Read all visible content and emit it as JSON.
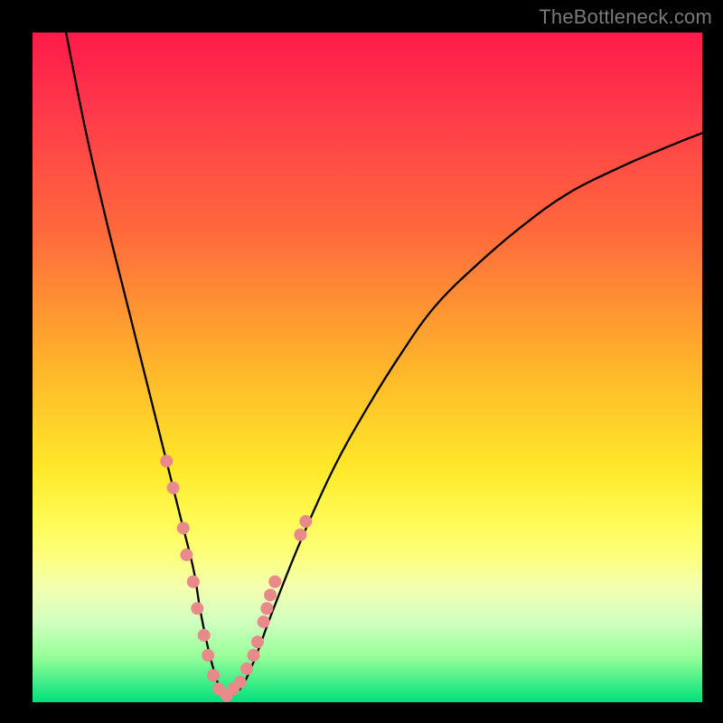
{
  "watermark": "TheBottleneck.com",
  "chart_data": {
    "type": "line",
    "title": "",
    "xlabel": "",
    "ylabel": "",
    "xlim": [
      0,
      100
    ],
    "ylim": [
      0,
      100
    ],
    "grid": false,
    "legend": false,
    "series": [
      {
        "name": "bottleneck-curve",
        "stroke": "#000000",
        "smooth": true,
        "x": [
          5,
          8,
          11,
          14,
          17,
          20,
          22,
          24,
          25,
          26,
          27,
          28,
          29,
          31,
          33,
          36,
          40,
          45,
          50,
          55,
          60,
          66,
          73,
          80,
          88,
          95,
          100
        ],
        "values": [
          100,
          85,
          72,
          60,
          48,
          36,
          28,
          20,
          14,
          9,
          5,
          2,
          1,
          2,
          6,
          14,
          24,
          35,
          44,
          52,
          59,
          65,
          71,
          76,
          80,
          83,
          85
        ]
      }
    ],
    "markers": {
      "name": "highlight-dots",
      "color": "#e98a8a",
      "radius": 7,
      "points": [
        {
          "x": 20.0,
          "y": 36
        },
        {
          "x": 21.0,
          "y": 32
        },
        {
          "x": 22.5,
          "y": 26
        },
        {
          "x": 23.0,
          "y": 22
        },
        {
          "x": 24.0,
          "y": 18
        },
        {
          "x": 24.6,
          "y": 14
        },
        {
          "x": 25.6,
          "y": 10
        },
        {
          "x": 26.2,
          "y": 7
        },
        {
          "x": 27.0,
          "y": 4
        },
        {
          "x": 27.8,
          "y": 2
        },
        {
          "x": 29.0,
          "y": 1
        },
        {
          "x": 30.0,
          "y": 2
        },
        {
          "x": 31.0,
          "y": 3
        },
        {
          "x": 32.0,
          "y": 5
        },
        {
          "x": 33.0,
          "y": 7
        },
        {
          "x": 33.6,
          "y": 9
        },
        {
          "x": 34.5,
          "y": 12
        },
        {
          "x": 35.0,
          "y": 14
        },
        {
          "x": 35.5,
          "y": 16
        },
        {
          "x": 36.2,
          "y": 18
        },
        {
          "x": 40.0,
          "y": 25
        },
        {
          "x": 40.8,
          "y": 27
        }
      ]
    }
  }
}
